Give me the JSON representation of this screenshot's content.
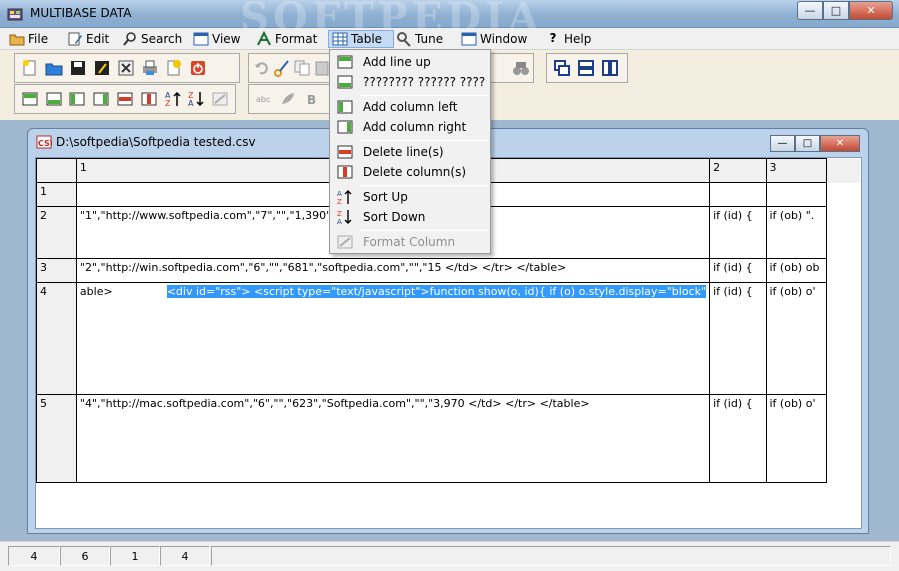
{
  "window": {
    "title": "MULTIBASE DATA",
    "watermark": "SOFTPEDIA"
  },
  "menubar": [
    {
      "label": "File",
      "icon": "folder-icon"
    },
    {
      "label": "Edit",
      "icon": "edit-icon"
    },
    {
      "label": "Search",
      "icon": "magnifier-icon"
    },
    {
      "label": "View",
      "icon": "view-icon"
    },
    {
      "label": "Format",
      "icon": "format-icon"
    },
    {
      "label": "Table",
      "icon": "table-icon"
    },
    {
      "label": "Tune",
      "icon": "tune-icon"
    },
    {
      "label": "Window",
      "icon": "window-icon"
    },
    {
      "label": "Help",
      "icon": "help-icon"
    }
  ],
  "table_menu": [
    {
      "label": "Add line up",
      "icon": "add-line-icon",
      "enabled": true
    },
    {
      "label": "???????? ?????? ????",
      "icon": "add-line-down-icon",
      "enabled": true
    },
    {
      "label": "Add column left",
      "icon": "add-column-left-icon",
      "enabled": true
    },
    {
      "label": "Add column right",
      "icon": "add-column-right-icon",
      "enabled": true
    },
    {
      "label": "Delete line(s)",
      "icon": "delete-line-icon",
      "enabled": true
    },
    {
      "label": "Delete column(s)",
      "icon": "delete-column-icon",
      "enabled": true
    },
    {
      "label": "Sort Up",
      "icon": "sort-up-icon",
      "enabled": true
    },
    {
      "label": "Sort Down",
      "icon": "sort-down-icon",
      "enabled": true
    },
    {
      "label": "Format Column",
      "icon": "format-column-icon",
      "enabled": false
    }
  ],
  "document": {
    "title": "D:\\softpedia\\Softpedia tested.csv",
    "columns": [
      "1",
      "2",
      "3"
    ],
    "rows": [
      {
        "num": "1",
        "cells": [
          "",
          "",
          ""
        ]
      },
      {
        "num": "2",
        "cells": [
          "\"1\",\"http://www.softpedia.com\",\"7\",\"\",\"1,390\"                                                    </td>       </tr>    </table",
          "if (id) {",
          "if (ob) \"."
        ]
      },
      {
        "num": "3",
        "cells": [
          "\"2\",\"http://win.softpedia.com\",\"6\",\"\",\"681\",\"softpedia.com\",\"\",\"15                      </td>       </tr>    </table>",
          "if (id) {",
          "if (ob) ob"
        ]
      },
      {
        "num": "4",
        "cells": [
          "able>",
          "if (id) {",
          "if (ob) o'"
        ],
        "selected_text": "<div id=\"rss\">         <script type=\"text/javascript\">function show(o, id){     if (o) o.style.display=\"block\""
      },
      {
        "num": "5",
        "cells": [
          "\"4\",\"http://mac.softpedia.com\",\"6\",\"\",\"623\",\"Softpedia.com\",\"\",\"3,970                    </td>       </tr>    </table>",
          "if (id) {",
          "if (ob) o'"
        ]
      }
    ]
  },
  "statusbar": [
    "4",
    "6",
    "1",
    "4"
  ]
}
